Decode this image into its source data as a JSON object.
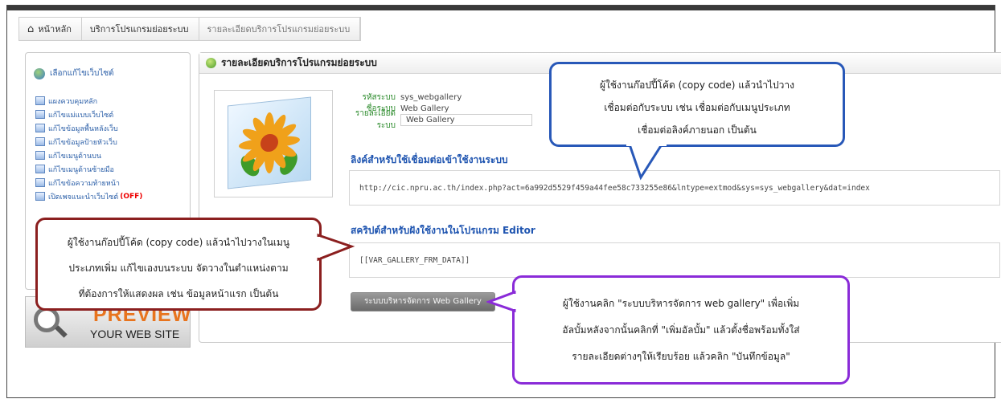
{
  "breadcrumb": {
    "home_icon": "home-icon",
    "home": "หน้าหลัก",
    "section": "บริการโปรแกรมย่อยระบบ",
    "current": "รายละเอียดบริการโปรแกรมย่อยระบบ"
  },
  "sidebar": {
    "header_icon": "globe-icon",
    "header": "เลือกแก้ไขเว็บไซต์",
    "items": [
      {
        "label": "แผงควบคุมหลัก",
        "icon": "dashboard-icon"
      },
      {
        "label": "แก้ไขแม่แบบเว็บไซต์",
        "icon": "template-icon"
      },
      {
        "label": "แก้ไขข้อมูลพื้นหลังเว็บ",
        "icon": "background-icon"
      },
      {
        "label": "แก้ไขข้อมูลป้ายหัวเว็บ",
        "icon": "banner-icon"
      },
      {
        "label": "แก้ไขเมนูด้านบน",
        "icon": "menu-icon"
      },
      {
        "label": "แก้ไขเมนูด้านซ้ายมือ",
        "icon": "menu-icon"
      },
      {
        "label": "แก้ไขข้อความท้ายหน้า",
        "icon": "footer-icon"
      },
      {
        "label": "เปิดเพจแนะนำเว็บไซต์",
        "icon": "page-icon",
        "badge": "(OFF)"
      }
    ],
    "preview": {
      "line1": "PREVIEW",
      "line2": "YOUR WEB SITE",
      "icon": "magnifier-icon"
    }
  },
  "main": {
    "title_icon": "leaf-icon",
    "title": "รายละเอียดบริการโปรแกรมย่อยระบบ",
    "info": {
      "code_label": "รหัสระบบ",
      "code_value": "sys_webgallery",
      "name_label": "ชื่อระบบ",
      "name_value": "Web Gallery",
      "detail_label": "รายละเอียดระบบ",
      "detail_value": "Web Gallery"
    },
    "link_section_title": "ลิงค์สำหรับใช้เชื่อมต่อเข้าใช้งานระบบ",
    "link_url": "http://cic.npru.ac.th/index.php?act=6a992d5529f459a44fee58c733255e86&lntype=extmod&sys=sys_webgallery&dat=index",
    "script_section_title": "สคริปต์สำหรับฝังใช้งานในโปรแกรม Editor",
    "script_code": "[[VAR_GALLERY_FRM_DATA]]",
    "manage_button": "ระบบบริหารจัดการ Web Gallery"
  },
  "callouts": {
    "blue": [
      "ผู้ใช้งานก๊อปปี้โค้ด (copy code) แล้วนำไปวาง",
      "เชื่อมต่อกับระบบ เช่น เชื่อมต่อกับเมนูประเภท",
      "เชื่อมต่อลิงค์ภายนอก เป็นต้น"
    ],
    "red": [
      "ผู้ใช้งานก๊อปปี้โค้ด (copy code) แล้วนำไปวางในเมนู",
      "ประเภทเพิ่ม แก้ไขเองบนระบบ จัดวางในตำแหน่งตาม",
      "ที่ต้องการให้แสดงผล เช่น ข้อมูลหน้าแรก เป็นต้น"
    ],
    "purple": [
      "ผู้ใช้งานคลิก \"ระบบบริหารจัดการ web gallery\" เพื่อเพิ่ม",
      "อัลบั้มหลังจากนั้นคลิกที่ \"เพิ่มอัลบั้ม\" แล้วตั้งชื่อพร้อมทั้งใส่",
      "รายละเอียดต่างๆให้เรียบร้อย แล้วคลิก \"บันทึกข้อมูล\""
    ]
  },
  "colors": {
    "blue_callout": "#2858b8",
    "red_callout": "#8b1f1f",
    "purple_callout": "#8a2bd8",
    "section_title": "#1e54b0",
    "label_green": "#2a8a2a",
    "off_badge": "#ee0000"
  }
}
